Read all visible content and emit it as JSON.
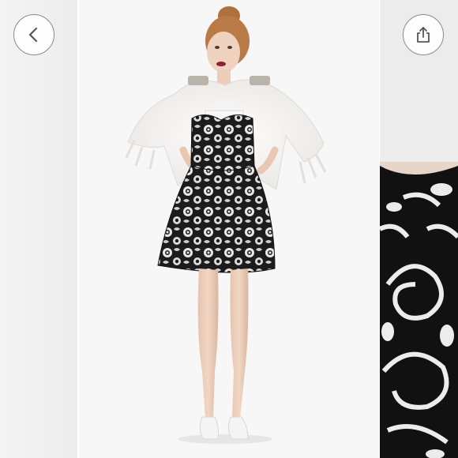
{
  "gallery": {
    "current_slide": 2,
    "slides": [
      {
        "name": "previous-photo"
      },
      {
        "name": "dress-full-length-photo"
      },
      {
        "name": "dress-fabric-closeup-photo"
      }
    ]
  },
  "controls": {
    "back_icon": "chevron-left-icon",
    "share_icon": "share-icon"
  },
  "colors": {
    "button_border": "#8a8a8a",
    "icon": "#555555",
    "background": "#f7f7f7"
  }
}
